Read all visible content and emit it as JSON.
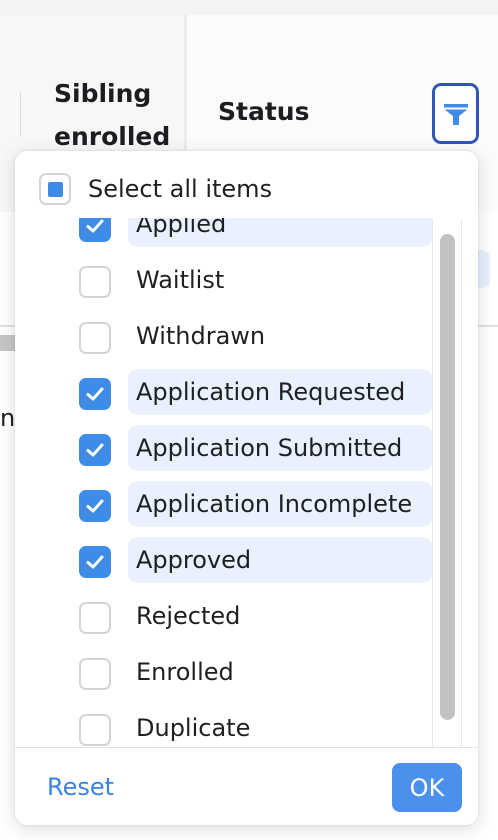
{
  "table_header": {
    "column_sibling": "Sibling enrolled",
    "column_status": "Status",
    "filter_icon": "filter-funnel-icon",
    "background_partial_text": "nc"
  },
  "filter_popup": {
    "select_all_label": "Select all items",
    "select_all_state": "indeterminate",
    "items": [
      {
        "label": "Applied",
        "checked": true
      },
      {
        "label": "Waitlist",
        "checked": false
      },
      {
        "label": "Withdrawn",
        "checked": false
      },
      {
        "label": "Application Requested",
        "checked": true
      },
      {
        "label": "Application Submitted",
        "checked": true
      },
      {
        "label": "Application Incomplete",
        "checked": true
      },
      {
        "label": "Approved",
        "checked": true
      },
      {
        "label": "Rejected",
        "checked": false
      },
      {
        "label": "Enrolled",
        "checked": false
      },
      {
        "label": "Duplicate",
        "checked": false
      }
    ],
    "reset_label": "Reset",
    "ok_label": "OK"
  },
  "colors": {
    "accent": "#3f8be8",
    "ok_button": "#4a90ec",
    "highlight": "#e8f1fd",
    "filter_border": "#2f56b8"
  }
}
